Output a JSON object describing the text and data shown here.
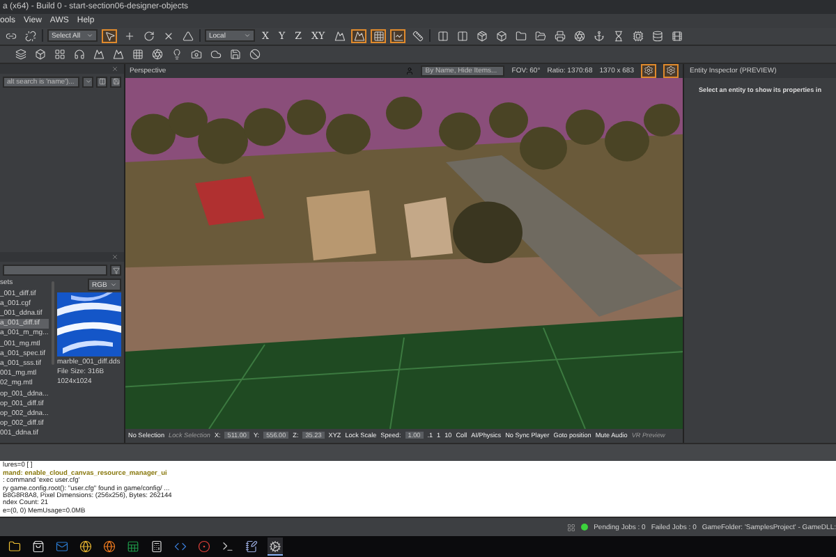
{
  "window": {
    "title": "a (x64) - Build 0 - start-section06-designer-objects"
  },
  "menu": [
    "ools",
    "View",
    "AWS",
    "Help"
  ],
  "toolbar": {
    "selection": "Select All",
    "coordinate": "Local",
    "axes": [
      "X",
      "Y",
      "Z",
      "XY"
    ],
    "tools": [
      {
        "selected": true
      },
      {
        "selected": false
      },
      {
        "selected": false
      },
      {
        "selected": false
      },
      {
        "selected": false
      },
      {
        "selected": false
      },
      {
        "selected": true
      },
      {
        "selected": true
      },
      {
        "selected": true
      },
      {
        "selected": false
      }
    ]
  },
  "outliner": {
    "search_placeholder": "alt search is 'name')..."
  },
  "asset_browser": {
    "root": "sets",
    "channel": "RGB",
    "files": [
      {
        "name": "_001_diff.tif",
        "selected": false
      },
      {
        "name": "a_001.cgf",
        "selected": false
      },
      {
        "name": "_001_ddna.tif",
        "selected": false
      },
      {
        "name": "a_001_diff.tif",
        "selected": true
      },
      {
        "name": "a_001_m_mg...",
        "selected": false
      },
      {
        "name": "_001_mg.mtl",
        "selected": false
      },
      {
        "name": "a_001_spec.tif",
        "selected": false
      },
      {
        "name": "a_001_sss.tif",
        "selected": false
      },
      {
        "name": "001_mg.mtl",
        "selected": false
      },
      {
        "name": "02_mg.mtl",
        "selected": false
      },
      {
        "name": "op_001_ddna...",
        "selected": false
      },
      {
        "name": "op_001_diff.tif",
        "selected": false
      },
      {
        "name": "op_002_ddna...",
        "selected": false
      },
      {
        "name": "op_002_diff.tif",
        "selected": false
      },
      {
        "name": "001_ddna.tif",
        "selected": false
      }
    ],
    "preview": {
      "name": "marble_001_diff.dds",
      "size": "File Size: 316B",
      "dimensions": "1024x1024"
    }
  },
  "viewport": {
    "title": "Perspective",
    "search_placeholder": "By Name, Hide Items...",
    "fov": "FOV: 60°",
    "ratio": "Ratio: 1370:68",
    "resolution": "1370 x 683"
  },
  "viewport_status": [
    {
      "text": "No Selection",
      "kind": "label",
      "disabled": false
    },
    {
      "text": "Lock Selection",
      "kind": "label",
      "disabled": true
    },
    {
      "text": "X:",
      "kind": "label",
      "disabled": false
    },
    {
      "text": "511.00",
      "kind": "field"
    },
    {
      "text": "Y:",
      "kind": "label",
      "disabled": false
    },
    {
      "text": "556.00",
      "kind": "field"
    },
    {
      "text": "Z:",
      "kind": "label",
      "disabled": false
    },
    {
      "text": "35.23",
      "kind": "field"
    },
    {
      "text": "XYZ",
      "kind": "label",
      "disabled": false
    },
    {
      "text": "Lock Scale",
      "kind": "label",
      "disabled": false
    },
    {
      "text": "Speed:",
      "kind": "label",
      "disabled": false
    },
    {
      "text": "1.00",
      "kind": "field"
    },
    {
      "text": ".1",
      "kind": "label",
      "disabled": false
    },
    {
      "text": "1",
      "kind": "label",
      "disabled": false
    },
    {
      "text": "10",
      "kind": "label",
      "disabled": false
    },
    {
      "text": "Coll",
      "kind": "label",
      "disabled": false
    },
    {
      "text": "AI/Physics",
      "kind": "label",
      "disabled": false
    },
    {
      "text": "No Sync Player",
      "kind": "label",
      "disabled": false
    },
    {
      "text": "Goto position",
      "kind": "label",
      "disabled": false
    },
    {
      "text": "Mute Audio",
      "kind": "label",
      "disabled": false
    },
    {
      "text": "VR Preview",
      "kind": "label",
      "disabled": true
    }
  ],
  "inspector": {
    "title": "Entity Inspector (PREVIEW)",
    "message": "Select an entity to show its properties in"
  },
  "console": [
    {
      "text": "lures=0 [ ]",
      "kind": "output"
    },
    {
      "text": "mand: enable_cloud_canvas_resource_manager_ui",
      "kind": "command"
    },
    {
      "text": ": command 'exec user.cfg'",
      "kind": "output"
    },
    {
      "text": "ry game.config.root(): \"user.cfg\" found in game/config/ ...",
      "kind": "output"
    },
    {
      "text": "B8G8R8A8, Pixel Dimensions: (256x256), Bytes: 262144",
      "kind": "output"
    },
    {
      "text": "ndex Count: 21",
      "kind": "output"
    },
    {
      "text": "e=(0, 0) MemUsage=0.0MB",
      "kind": "output"
    }
  ],
  "status_bar": {
    "jobs_ok": true,
    "pending": "Pending Jobs : 0",
    "failed": "Failed Jobs : 0",
    "game": "GameFolder: 'SamplesProject' - GameDLL:"
  }
}
